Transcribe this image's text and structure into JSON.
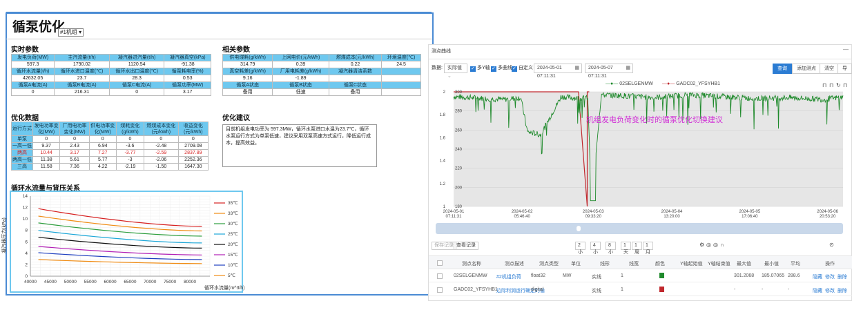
{
  "left": {
    "title": "循泵优化",
    "unit_select": "#1机组",
    "realtime": {
      "title": "实时参数",
      "headers": [
        [
          "发电负荷(MW)",
          "主汽流量(t/h)",
          "凝汽器进汽量(t/h)",
          "凝汽器真空(kPa)"
        ],
        [
          "循环水流量(t/h)",
          "循环水进口温度(℃)",
          "循环水出口温度(℃)",
          "循泵耗电率(%)"
        ],
        [
          "循泵A电流(A)",
          "循泵B电流(A)",
          "循泵C电流(A)",
          "循泵功率(MW)"
        ]
      ],
      "values": [
        [
          "597.3",
          "1790.02",
          "1120.54",
          "-91.38"
        ],
        [
          "42632.05",
          "23.7",
          "28.3",
          "0.53"
        ],
        [
          "0",
          "216.31",
          "0",
          "3.17"
        ]
      ]
    },
    "related": {
      "title": "相关参数",
      "headers": [
        [
          "供电煤耗(g/kWh)",
          "上网电价(元/kWh)",
          "燃煤成本(元/kWh)",
          "环境温度(℃)"
        ],
        [
          "真空耗差(g/kWh)",
          "厂用电耗差(g/kWh)",
          "凝汽器清洁系数",
          ""
        ],
        [
          "循泵A状态",
          "循泵B状态",
          "循泵C状态",
          ""
        ]
      ],
      "values": [
        [
          "314.79",
          "0.39",
          "0.22",
          "24.5"
        ],
        [
          "9.16",
          "-1.89",
          "",
          ""
        ],
        [
          "备用",
          "低速",
          "备用",
          ""
        ]
      ]
    },
    "optimize": {
      "title": "优化数据",
      "headers": [
        "运行方式",
        "发电功率变化(MW)",
        "厂用电功率变化(MW)",
        "供电功率变化(MW)",
        "煤耗变化(g/kWh)",
        "燃煤成本变化(元/kWh)",
        "收益变化(元/kWh)"
      ],
      "rows": [
        [
          "单泵",
          "0",
          "0",
          "0",
          "0",
          "0",
          "0"
        ],
        [
          "一高一低",
          "9.37",
          "2.43",
          "6.94",
          "-3.6",
          "-2.48",
          "2709.08"
        ],
        [
          "两高",
          "10.44",
          "3.17",
          "7.27",
          "-3.77",
          "-2.59",
          "2837.89"
        ],
        [
          "两高一低",
          "11.38",
          "5.61",
          "5.77",
          "-3",
          "-2.06",
          "2252.36"
        ],
        [
          "三高",
          "11.58",
          "7.36",
          "4.22",
          "-2.19",
          "-1.50",
          "1647.30"
        ]
      ]
    },
    "advice": {
      "title": "优化建议",
      "text": "目前机组发电功率为 597.3MW，循环水泵进口水温为23.7℃，循环水泵运行方式为单泵低速，建议采用双泵高速方式运行，降低运行成本，提高效益。"
    },
    "curve": {
      "title": "循环水流量与背压关系",
      "ylabel": "凝汽器压力(kPa)",
      "xlabel": "循环水流量(m^3/h)"
    }
  },
  "right": {
    "title": "测点曲线",
    "toolbar": {
      "data_label": "数据:",
      "data_select": "实际值",
      "multi_y": "多Y轴",
      "multi_curve": "多曲线",
      "custom": "自定义",
      "start": "2024-05-01 07:11:31",
      "end": "2024-05-07 07:11:31",
      "query": "查询",
      "add_point": "添加测点",
      "clear": "清空",
      "more": "导"
    },
    "chart_icons": [
      "⊓",
      "⊓",
      "↻",
      "⊓"
    ],
    "legend": [
      "02SELGENMW",
      "GADC02_YFSYHB1"
    ],
    "annotation": "机组发电负荷变化时的循泵优化切换建议",
    "table_btns": [
      "保存记录",
      "查看记录"
    ],
    "ranges": [
      "2小时",
      "4小时",
      "8小时",
      "1天",
      "1周",
      "1月"
    ],
    "table_icons": [
      "⚙",
      "◎",
      "◎",
      "∩"
    ],
    "table_refresh": "⊙",
    "columns": [
      "测点名称",
      "测点描述",
      "测点类型",
      "单位",
      "线形",
      "线宽",
      "颜色",
      "Y轴起始值",
      "Y轴结束值",
      "最大值",
      "最小值",
      "平均",
      "操作"
    ],
    "rows": [
      {
        "name": "02SELGENMW",
        "desc": "#2机组负荷",
        "type": "float32",
        "unit": "MW",
        "line": "实线",
        "width": "1",
        "color": "#1f8a2c",
        "max": "301.2068",
        "min": "185.07065",
        "avg": "288.6",
        "ops": [
          "隐藏",
          "修改",
          "删除"
        ]
      },
      {
        "name": "GADC02_YFSYHB1",
        "desc": "边际利润运行确定的循",
        "type": "digital",
        "unit": "",
        "line": "实线",
        "width": "1",
        "color": "#c0282d",
        "max": "-",
        "min": "-",
        "avg": "-",
        "ops": [
          "隐藏",
          "修改",
          "删除"
        ]
      }
    ],
    "chart_data": {
      "type": "line",
      "title": "",
      "x": [
        "2024-05-01 07:11:31",
        "2024-05-02 05:46:40",
        "2024-05-03 09:33:20",
        "2024-05-04 13:20:00",
        "2024-05-05 17:06:40",
        "2024-05-06 20:53:20"
      ],
      "xlabel": "",
      "ylabel": "",
      "y_left_ticks": [
        1,
        1.2,
        1.4,
        1.6,
        1.8,
        2
      ],
      "y_right_ticks": [
        180,
        200,
        220,
        240,
        260,
        280,
        300
      ],
      "series": [
        {
          "name": "02SELGENMW",
          "color": "#1f8a2c",
          "x_days": [
            0,
            0.5,
            0.75,
            1.0,
            1.1,
            1.3,
            1.35,
            1.6,
            1.9,
            2.0,
            2.05,
            2.2,
            2.5,
            3,
            3.5,
            4,
            4.5,
            5,
            5.5,
            6
          ],
          "values": [
            295,
            293,
            292,
            294,
            258,
            255,
            262,
            295,
            293,
            294,
            185,
            297,
            296,
            294,
            297,
            295,
            293,
            294,
            292,
            296
          ]
        },
        {
          "name": "GADC02_YFSYHB1",
          "color": "#c0282d",
          "segments": [
            [
              0.0,
              0.0,
              1.85,
              2.0
            ],
            [
              1.85,
              2.0,
              2.0,
              1.0
            ]
          ]
        }
      ]
    }
  }
}
